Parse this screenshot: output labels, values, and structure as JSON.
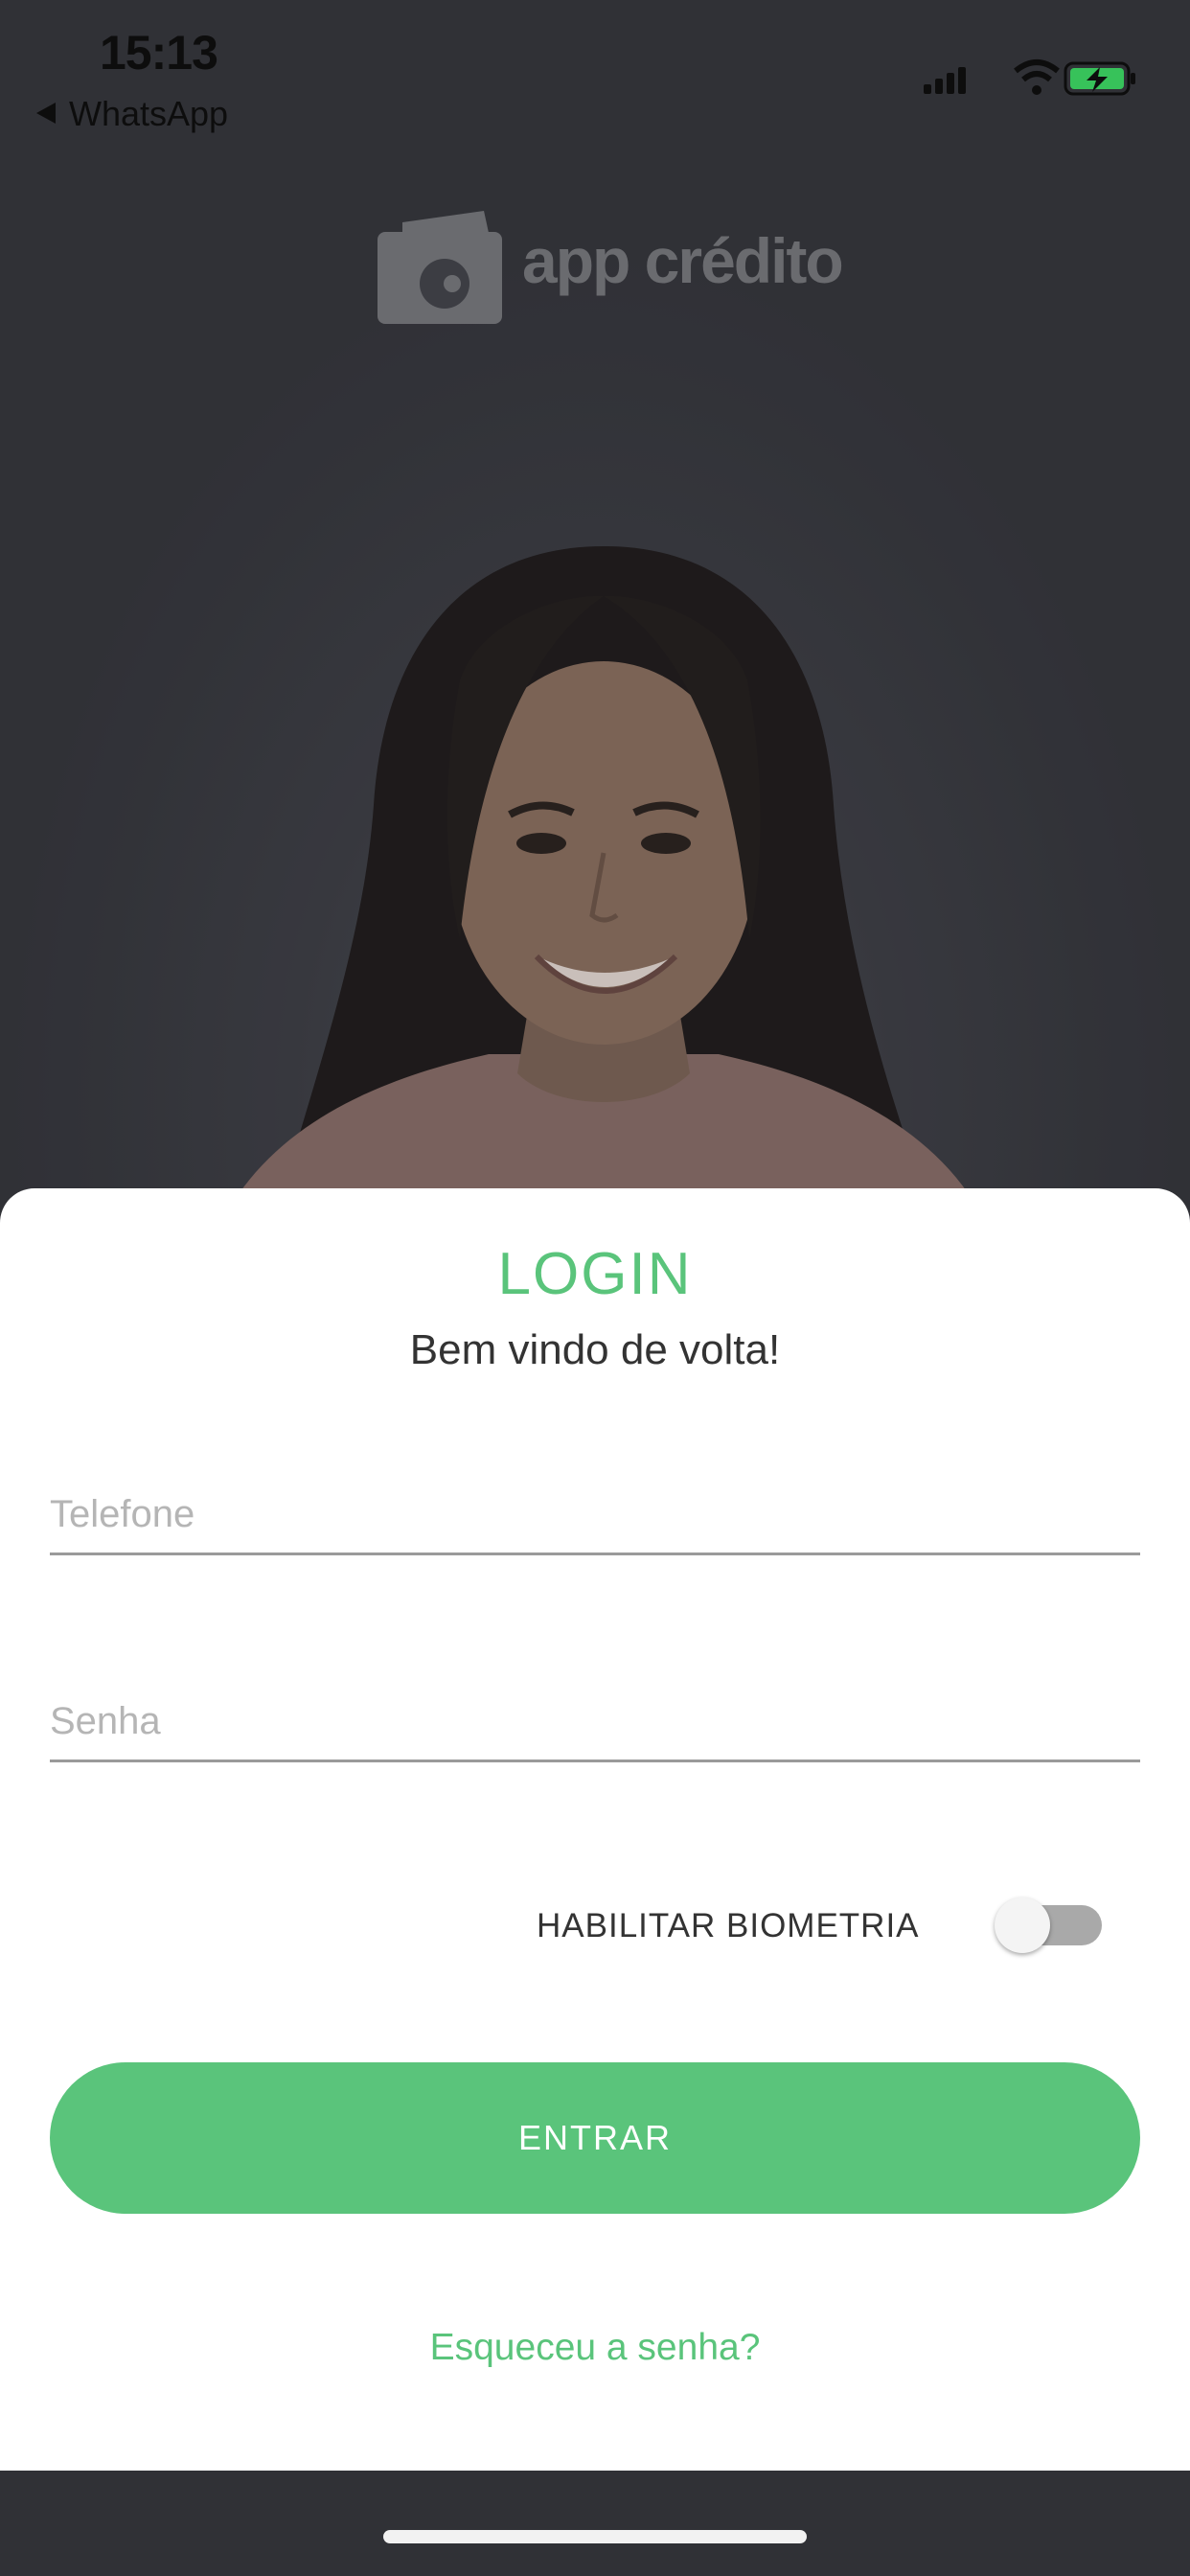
{
  "status_bar": {
    "time": "15:13",
    "back_app": "WhatsApp"
  },
  "logo": {
    "text": "app crédito"
  },
  "login": {
    "title": "LOGIN",
    "subtitle": "Bem vindo de volta!",
    "phone_placeholder": "Telefone",
    "phone_value": "",
    "password_placeholder": "Senha",
    "password_value": "",
    "biometrics_label": "HABILITAR BIOMETRIA",
    "biometrics_enabled": false,
    "enter_label": "ENTRAR",
    "forgot_label": "Esqueceu a senha?"
  },
  "colors": {
    "accent": "#5ac47b",
    "backdrop": "#3a3b40",
    "toggle_off": "#a9a9a9"
  },
  "icons": [
    "back-arrow-icon",
    "cellular-signal-icon",
    "wifi-icon",
    "battery-charging-icon",
    "wallet-logo-icon"
  ]
}
